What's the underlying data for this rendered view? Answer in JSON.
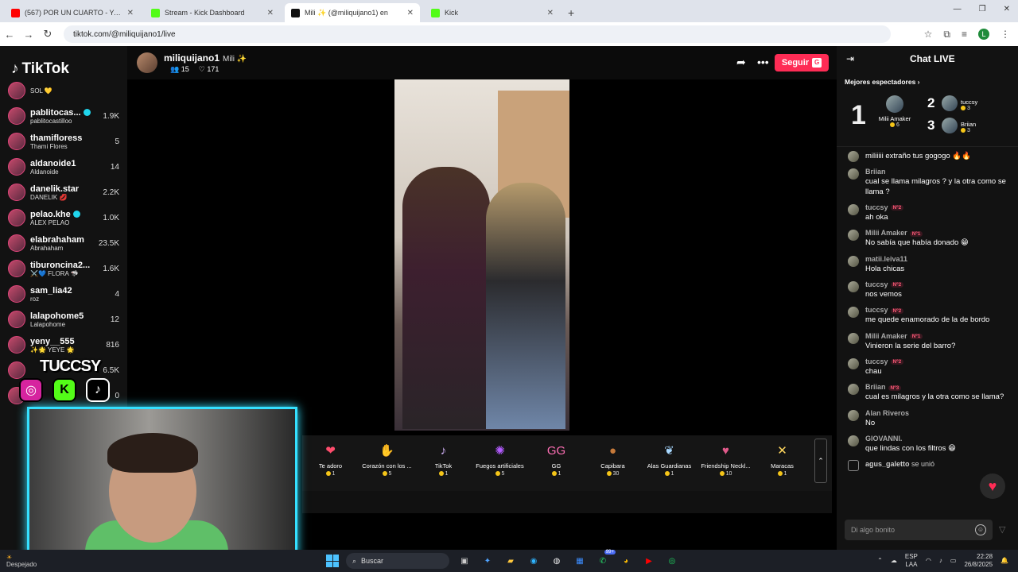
{
  "browser": {
    "tabs": [
      {
        "title": "(567) POR UN CUARTO - YouTu",
        "color": "#ff0000",
        "active": false
      },
      {
        "title": "Stream - Kick Dashboard",
        "color": "#53fc18",
        "active": false
      },
      {
        "title": "Mili ✨ (@miliquijano1) en",
        "color": "#111111",
        "active": true
      },
      {
        "title": "Kick",
        "color": "#53fc18",
        "active": false
      }
    ],
    "url": "tiktok.com/@miliquijano1/live"
  },
  "sidebar": {
    "logo": "TikTok",
    "items": [
      {
        "username": "",
        "display": "SOL 💛",
        "count": ""
      },
      {
        "username": "pablitocas...",
        "display": "pablitocastilloo",
        "count": "1.9K",
        "verified": true
      },
      {
        "username": "thamifloress",
        "display": "Thami Flores",
        "count": "5"
      },
      {
        "username": "aldanoide1",
        "display": "Aldanoide",
        "count": "14"
      },
      {
        "username": "danelik.star",
        "display": "DANELIK 💋",
        "count": "2.2K"
      },
      {
        "username": "pelao.khe",
        "display": "ALEX PELAO",
        "count": "1.0K",
        "verified": true
      },
      {
        "username": "elabrahaham",
        "display": "Abrahaham",
        "count": "23.5K"
      },
      {
        "username": "tiburoncina2...",
        "display": "⚔️💙 FLORA 🦈",
        "count": "1.6K"
      },
      {
        "username": "sam_lia42",
        "display": "roz",
        "count": "4"
      },
      {
        "username": "lalapohome5",
        "display": "Lalapohome",
        "count": "12"
      },
      {
        "username": "yeny__555",
        "display": "✨🌟 YEYE 🌟",
        "count": "816"
      },
      {
        "username": "",
        "display": "",
        "count": "6.5K"
      },
      {
        "username": "",
        "display": "",
        "count": "0"
      }
    ]
  },
  "stream": {
    "username": "miliquijano1",
    "nickname": "Mili ✨",
    "viewers": "15",
    "likes": "171",
    "follow_label": "Seguir",
    "follow_key": "G"
  },
  "overlay": {
    "name": "TUCCSY"
  },
  "gifts": [
    {
      "name": "Te adoro",
      "price": "1",
      "icon": "❤",
      "color": "#ff4d6d"
    },
    {
      "name": "Corazón con los ...",
      "price": "5",
      "icon": "✋",
      "color": "#ffb07a"
    },
    {
      "name": "TikTok",
      "price": "1",
      "icon": "♪",
      "color": "#d8b7ff"
    },
    {
      "name": "Fuegos artificiales",
      "price": "5",
      "icon": "✺",
      "color": "#b35cff"
    },
    {
      "name": "GG",
      "price": "1",
      "icon": "GG",
      "color": "#ff6fb5"
    },
    {
      "name": "Capibara",
      "price": "30",
      "icon": "●",
      "color": "#c77a3a"
    },
    {
      "name": "Alas Guardianas",
      "price": "1",
      "icon": "❦",
      "color": "#a8d8ff"
    },
    {
      "name": "Friendship Neckl...",
      "price": "10",
      "icon": "♥",
      "color": "#e05a8a"
    },
    {
      "name": "Maracas",
      "price": "1",
      "icon": "✕",
      "color": "#ffd75e"
    }
  ],
  "chat": {
    "title": "Chat LIVE",
    "top_label": "Mejores espectadores",
    "top1": {
      "name": "Milii Amaker",
      "count": "6"
    },
    "top2": {
      "name": "tuccsy",
      "count": "3"
    },
    "top3": {
      "name": "Briian",
      "count": "3"
    },
    "messages": [
      {
        "user": "",
        "rank": "",
        "text": "miliiiii extraño tus gogogo 🔥🔥"
      },
      {
        "user": "Briian",
        "rank": "",
        "text": "cual se llama milagros ? y la otra como se llama ?"
      },
      {
        "user": "tuccsy",
        "rank": "Nº2",
        "text": "ah oka"
      },
      {
        "user": "Milii Amaker",
        "rank": "Nº1",
        "text": "No sabía que había donado 😁"
      },
      {
        "user": "matii.leiva11",
        "rank": "",
        "text": "Hola chicas"
      },
      {
        "user": "tuccsy",
        "rank": "Nº2",
        "text": "nos vemos"
      },
      {
        "user": "tuccsy",
        "rank": "Nº2",
        "text": "me quede enamorado de la de bordo"
      },
      {
        "user": "Milii Amaker",
        "rank": "Nº1",
        "text": "Vinieron la serie del barro?"
      },
      {
        "user": "tuccsy",
        "rank": "Nº2",
        "text": "chau"
      },
      {
        "user": "Briian",
        "rank": "Nº3",
        "text": "cual es milagros y la otra como se llama?"
      },
      {
        "user": "Alan Riveros",
        "rank": "",
        "text": "No"
      },
      {
        "user": "GIOVANNI.",
        "rank": "",
        "text": "que lindas con los filtros 😁"
      }
    ],
    "joined_user": "agus_galetto",
    "joined_text": "se unió",
    "input_placeholder": "Di algo bonito"
  },
  "taskbar": {
    "weather": "Despejado",
    "search": "Buscar",
    "lang1": "ESP",
    "lang2": "LAA",
    "time": "22:28",
    "date": "26/8/2025",
    "badge": "99+"
  }
}
